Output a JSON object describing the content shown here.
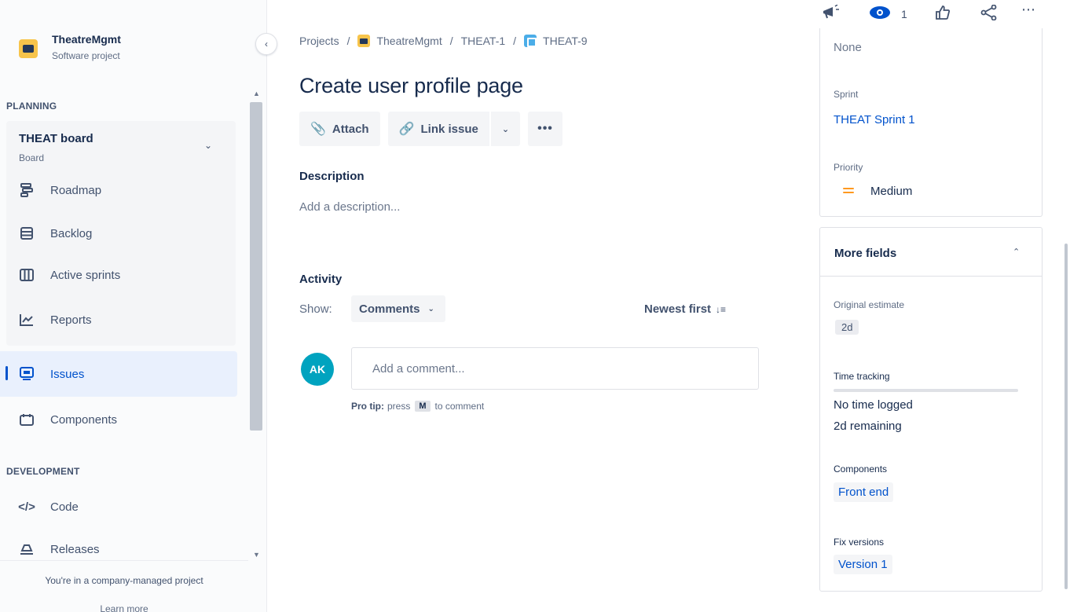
{
  "sidebar": {
    "project_name": "TheatreMgmt",
    "project_type": "Software project",
    "planning_label": "PLANNING",
    "board_title": "THEAT board",
    "board_sub": "Board",
    "items": [
      {
        "label": "Roadmap",
        "icon": "roadmap-icon"
      },
      {
        "label": "Backlog",
        "icon": "backlog-icon"
      },
      {
        "label": "Active sprints",
        "icon": "active-sprints-icon"
      },
      {
        "label": "Reports",
        "icon": "reports-icon"
      }
    ],
    "issues_label": "Issues",
    "components_label": "Components",
    "development_label": "DEVELOPMENT",
    "code_label": "Code",
    "releases_label": "Releases",
    "footer_text": "You're in a company-managed project",
    "footer_link": "Learn more"
  },
  "breadcrumb": {
    "projects": "Projects",
    "project": "TheatreMgmt",
    "parent": "THEAT-1",
    "issue": "THEAT-9",
    "separator": "/"
  },
  "issue": {
    "title": "Create user profile page"
  },
  "toolbar": {
    "attach_label": "Attach",
    "link_issue_label": "Link issue",
    "more_label": "•••"
  },
  "description": {
    "label": "Description",
    "placeholder": "Add a description..."
  },
  "activity": {
    "label": "Activity",
    "show_label": "Show:",
    "show_value": "Comments",
    "sort_label": "Newest first",
    "avatar_initials": "AK",
    "comment_placeholder": "Add a comment...",
    "pro_tip_label": "Pro tip:",
    "pro_tip_press": "press",
    "pro_tip_key": "M",
    "pro_tip_suffix": "to comment"
  },
  "top_actions": {
    "watch_count": "1"
  },
  "fields": {
    "top_value": "None",
    "sprint_label": "Sprint",
    "sprint_value": "THEAT Sprint 1",
    "priority_label": "Priority",
    "priority_value": "Medium",
    "more_fields_label": "More fields",
    "original_estimate_label": "Original estimate",
    "original_estimate_value": "2d",
    "time_tracking_label": "Time tracking",
    "time_logged": "No time logged",
    "time_remaining": "2d remaining",
    "components_label": "Components",
    "components_value": "Front end",
    "fix_versions_label": "Fix versions",
    "fix_versions_value": "Version 1"
  },
  "colors": {
    "accent": "#0052cc",
    "project_logo": "#f7c44b",
    "avatar": "#00a3bf",
    "priority_medium": "#ff991f"
  }
}
